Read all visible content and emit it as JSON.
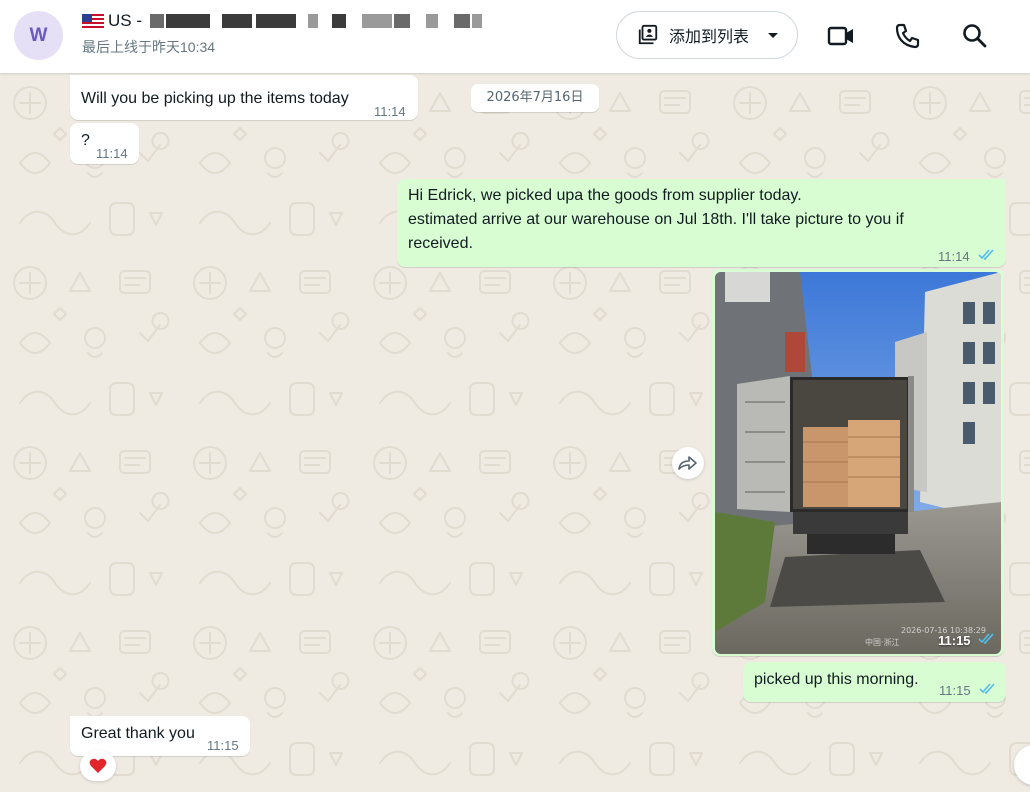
{
  "header": {
    "avatar_letter": "W",
    "contact_prefix": "US -",
    "last_seen": "最后上线于昨天10:34",
    "add_to_list_label": "添加到列表"
  },
  "chat": {
    "date_chip": "2026年7月16日",
    "messages": [
      {
        "direction": "in",
        "text": "Will you be picking up the items today",
        "time": "11:14"
      },
      {
        "direction": "in",
        "text": "?",
        "time": "11:14"
      },
      {
        "direction": "out",
        "lines": [
          "Hi Edrick, we picked upa the goods from supplier today.",
          "estimated arrive at our warehouse on Jul 18th. I'll take picture to you if",
          "received."
        ],
        "time": "11:14",
        "status": "read"
      },
      {
        "direction": "out",
        "type": "image",
        "image_desc": "truck-loaded-with-cartons",
        "watermark_line1": "2026-07-16 10:38:29",
        "watermark_line2": "中国·浙江",
        "time": "11:15",
        "status": "read"
      },
      {
        "direction": "out",
        "text": "picked up this morning.",
        "time": "11:15",
        "status": "read"
      },
      {
        "direction": "in",
        "text": "Great thank you",
        "time": "11:15",
        "reaction": "❤️"
      }
    ]
  },
  "colors": {
    "outgoing_bubble": "#d9fdd3",
    "incoming_bubble": "#ffffff",
    "read_ticks": "#53bdeb",
    "chat_background": "#efeae2"
  }
}
